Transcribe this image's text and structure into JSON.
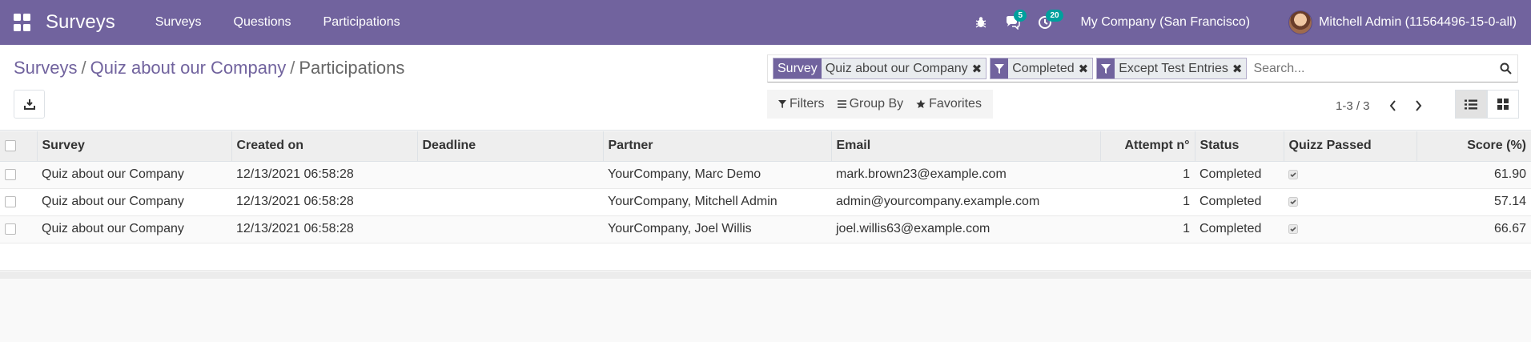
{
  "navbar": {
    "brand": "Surveys",
    "menus": [
      "Surveys",
      "Questions",
      "Participations"
    ],
    "chat_badge": "5",
    "activity_badge": "20",
    "company": "My Company (San Francisco)",
    "user": "Mitchell Admin (11564496-15-0-all)"
  },
  "breadcrumb": {
    "items": [
      "Surveys",
      "Quiz about our Company"
    ],
    "active": "Participations",
    "separator": "/"
  },
  "search": {
    "facets": [
      {
        "label": "Survey",
        "value": "Quiz about our Company",
        "kind": "field"
      },
      {
        "value": "Completed",
        "kind": "filter"
      },
      {
        "value": "Except Test Entries",
        "kind": "filter"
      }
    ],
    "placeholder": "Search..."
  },
  "filters": {
    "filters_label": "Filters",
    "groupby_label": "Group By",
    "favorites_label": "Favorites"
  },
  "pager": {
    "value": "1-3 / 3"
  },
  "table": {
    "columns": [
      "Survey",
      "Created on",
      "Deadline",
      "Partner",
      "Email",
      "Attempt n°",
      "Status",
      "Quizz Passed",
      "Score (%)"
    ],
    "rows": [
      {
        "survey": "Quiz about our Company",
        "created_on": "12/13/2021 06:58:28",
        "deadline": "",
        "partner": "YourCompany, Marc Demo",
        "email": "mark.brown23@example.com",
        "attempt": "1",
        "status": "Completed",
        "passed": true,
        "score": "61.90"
      },
      {
        "survey": "Quiz about our Company",
        "created_on": "12/13/2021 06:58:28",
        "deadline": "",
        "partner": "YourCompany, Mitchell Admin",
        "email": "admin@yourcompany.example.com",
        "attempt": "1",
        "status": "Completed",
        "passed": true,
        "score": "57.14"
      },
      {
        "survey": "Quiz about our Company",
        "created_on": "12/13/2021 06:58:28",
        "deadline": "",
        "partner": "YourCompany, Joel Willis",
        "email": "joel.willis63@example.com",
        "attempt": "1",
        "status": "Completed",
        "passed": true,
        "score": "66.67"
      }
    ]
  },
  "colors": {
    "brand": "#71639e",
    "badge": "#00a09d"
  }
}
